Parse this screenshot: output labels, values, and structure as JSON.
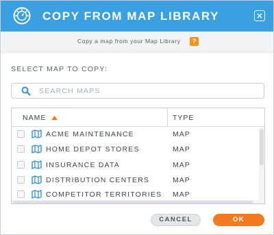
{
  "dialog": {
    "title": "COPY FROM MAP LIBRARY",
    "subtitle": "Copy a map from your Map Library",
    "help_label": "?",
    "section_label": "SELECT MAP TO COPY:",
    "colors": {
      "header": "#3aa0e2",
      "accent": "#f47a20",
      "map_icon": "#2f8fd8"
    }
  },
  "search": {
    "placeholder": "SEARCH MAPS",
    "value": ""
  },
  "table": {
    "columns": {
      "name": "NAME",
      "type": "TYPE"
    },
    "sort": {
      "column": "name",
      "direction": "ascending"
    },
    "rows": [
      {
        "name": "ACME MAINTENANCE",
        "type": "MAP",
        "checked": false
      },
      {
        "name": "HOME DEPOT STORES",
        "type": "MAP",
        "checked": false
      },
      {
        "name": "INSURANCE DATA",
        "type": "MAP",
        "checked": false
      },
      {
        "name": "DISTRIBUTION CENTERS",
        "type": "MAP",
        "checked": false
      },
      {
        "name": "COMPETITOR TERRITORIES",
        "type": "MAP",
        "checked": false
      }
    ]
  },
  "footer": {
    "cancel_label": "CANCEL",
    "ok_label": "OK"
  }
}
